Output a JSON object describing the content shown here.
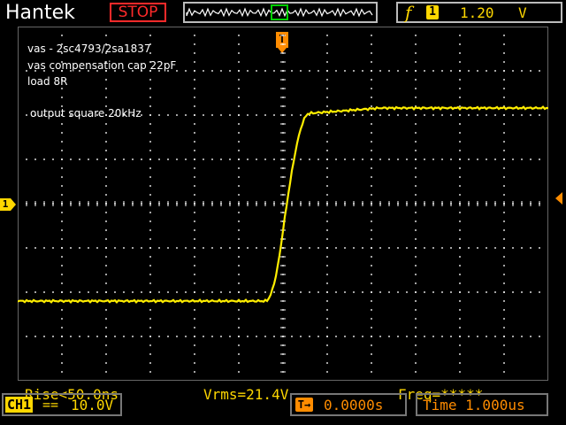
{
  "header": {
    "brand": "Hantek",
    "run_state": "STOP",
    "trigger_icon": "f",
    "trigger_channel": "1",
    "trigger_level": "1.20",
    "trigger_unit": "V"
  },
  "notes": {
    "line1": "vas - 2sc4793/2sa1837",
    "line2": "vas compensation cap 22pF",
    "line3": "load 8R",
    "line4": "output square 20kHz"
  },
  "measurements": {
    "rise": "Rise<50.0ns",
    "vrms": "Vrms=21.4V",
    "freq": "Freq=*****"
  },
  "markers": {
    "trigger_pos": "T",
    "channel": "1"
  },
  "footer": {
    "channel_tag": "CH1",
    "coupling": "==",
    "volts_div": "10.0V",
    "position_icon": "T→",
    "position": "0.0000s",
    "timebase": "Time 1.000us"
  },
  "colors": {
    "trace": "#ffee00",
    "grid": "#ffffff",
    "accent": "#ff8c00",
    "alert": "#ff2a2a"
  }
}
